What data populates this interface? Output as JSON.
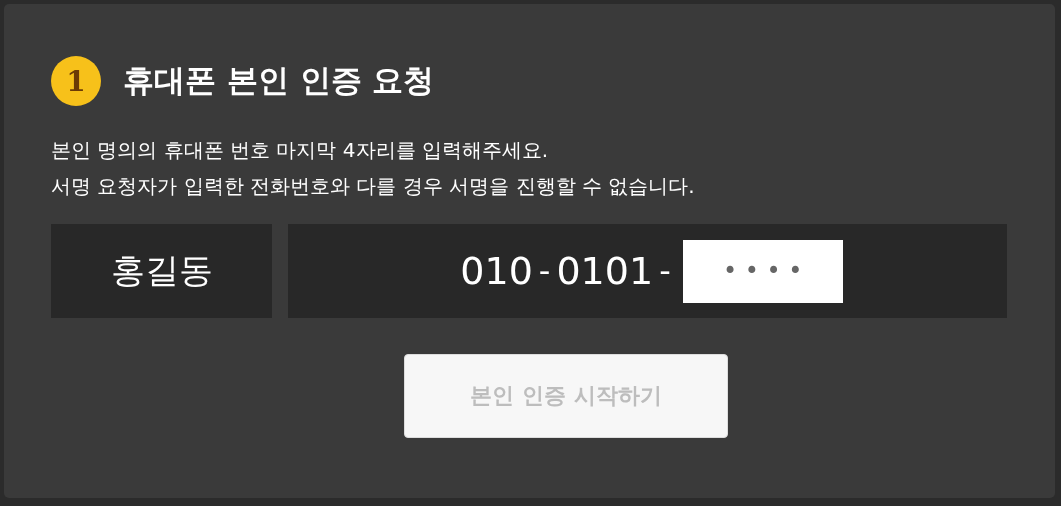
{
  "step": {
    "number": "1",
    "title": "휴대폰 본인 인증 요청"
  },
  "description": [
    "본인 명의의 휴대폰 번호 마지막 4자리를 입력해주세요.",
    "서명 요청자가 입력한 전화번호와 다를 경우 서명을 진행할 수 없습니다."
  ],
  "name": "홍길동",
  "phone": {
    "prefix": "010",
    "middle": "0101",
    "separator": "-",
    "last_digits": {
      "placeholder": "• • • •"
    }
  },
  "button": {
    "label": "본인 인증 시작하기",
    "disabled": true
  }
}
